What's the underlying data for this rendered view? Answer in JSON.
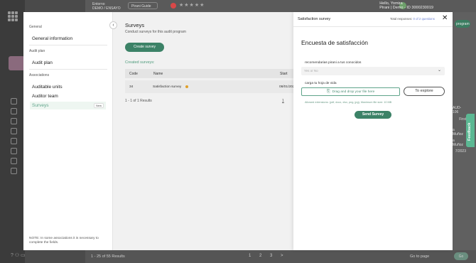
{
  "header": {
    "logo_line1": "Entorno",
    "logo_line2": "DEMO / ENSAYO",
    "workspace": "Pirani Guide",
    "user_name": "Hello, Yomira",
    "user_sub": "Pirani | Demo - ID 3000230019"
  },
  "left_panel": {
    "general_section": "General",
    "general_info": "General information",
    "audit_plan_section": "Audit plan",
    "audit_plan": "Audit plan",
    "associations_section": "Associations",
    "auditable_units": "Auditable units",
    "auditor_team": "Auditor team",
    "surveys": "Surveys",
    "new_badge": "New",
    "note": "NOTE: In some associations it is necessary to complete the fields."
  },
  "surveys_panel": {
    "title": "Surveys",
    "subtitle": "Conduct surveys for this audit program",
    "create_button": "Create survey",
    "created_label": "Created surveys:",
    "columns": {
      "code": "Code",
      "name": "Name",
      "start": "Start"
    },
    "rows": [
      {
        "code": "34",
        "name": "Satisfaction survey",
        "start": "08/01/202"
      }
    ],
    "results": "1 - 1 of 1 Results",
    "page": "1"
  },
  "survey_form": {
    "header_title": "Satisfaction survey",
    "total_prefix": "Total responses:",
    "total_value": "0 of 2 questions",
    "title": "Encuesta de satisfacción",
    "question1": "recomendarias pirani a tus conocidos",
    "question1_placeholder": "Yes or No",
    "question2": "carga tu hoja de vida",
    "upload_label": "Drag and drop your file here",
    "explore_button": "To explore",
    "allowed": "Allowed extensions: (pdf, docx, xlsx, png, jpg), Maximum file size: 10 MB",
    "send_button": "Send Survey"
  },
  "background": {
    "program_button": "program",
    "code_text": "AUD-106",
    "first_text": "First",
    "name_text_1": "a Muñoz",
    "name_text_2": "a Muñoz",
    "date_text": "7/2023",
    "feedback": "Feedback",
    "footer_results": "1 - 25 of 55 Results",
    "pages": "1 2 3 >",
    "go_to_page": "Go to page",
    "go": "Go"
  }
}
